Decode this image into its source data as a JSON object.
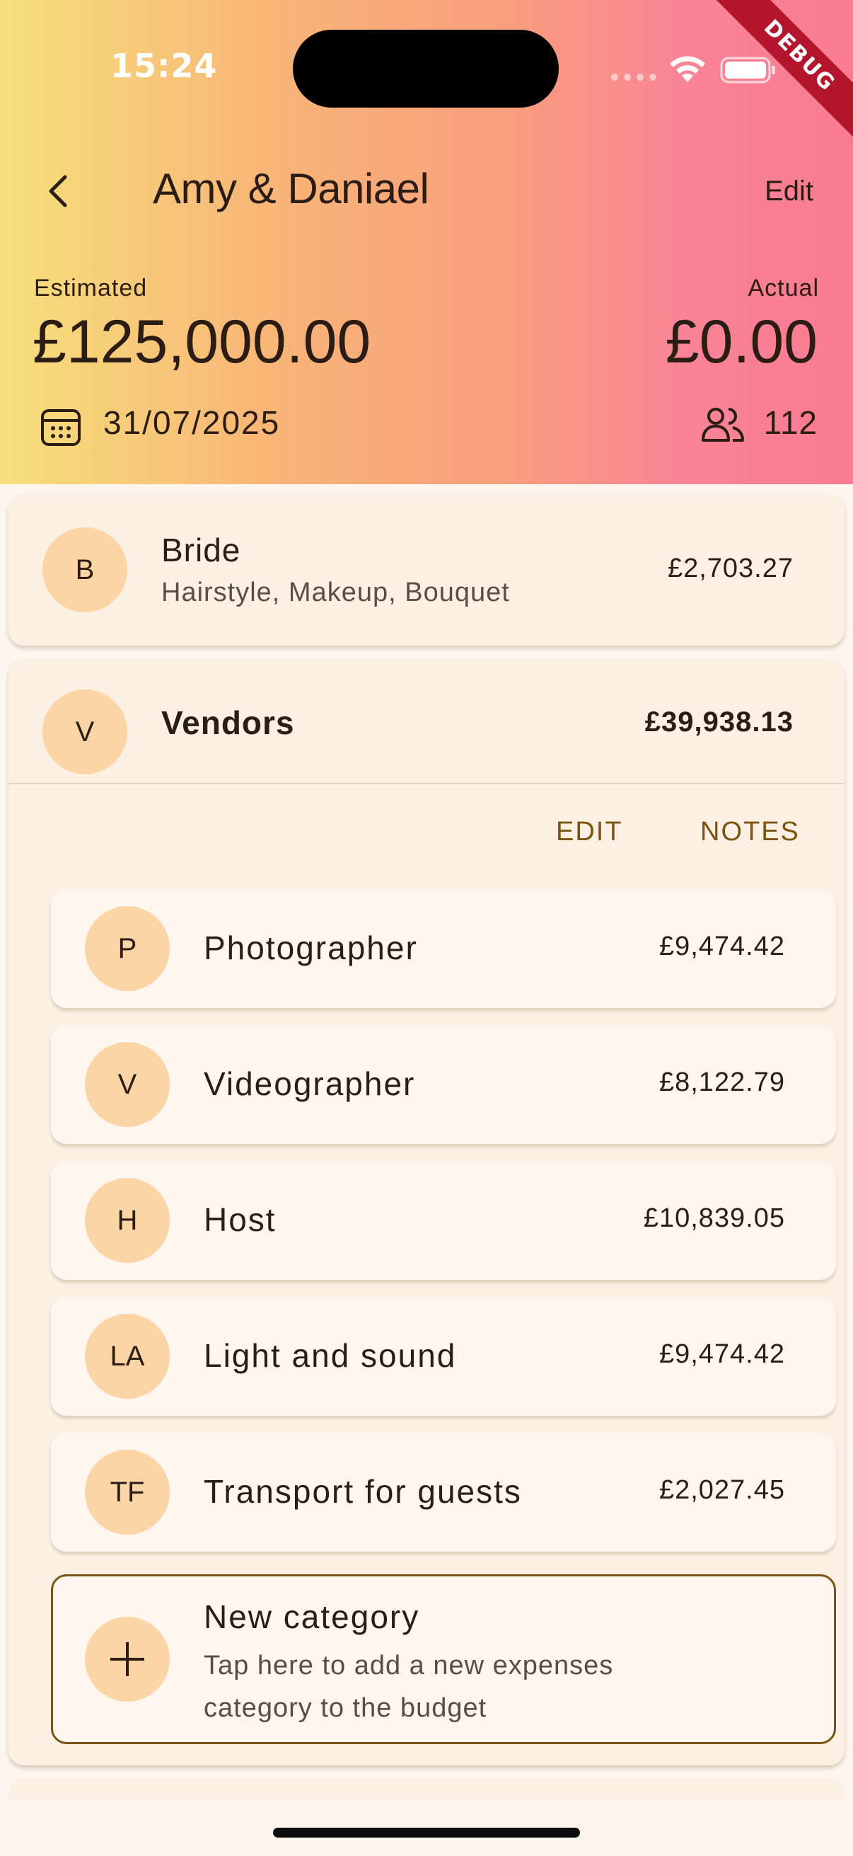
{
  "status_bar": {
    "time": "15:24"
  },
  "debug_banner": "DEBUG",
  "header": {
    "title": "Amy & Daniael",
    "edit_label": "Edit",
    "estimated_label": "Estimated",
    "estimated_value": "£125,000.00",
    "actual_label": "Actual",
    "actual_value": "£0.00",
    "date": "31/07/2025",
    "guest_count": "112",
    "icons": {
      "back": "chevron-left-icon",
      "calendar": "calendar-icon",
      "guests": "people-icon"
    }
  },
  "categories": {
    "bride": {
      "initial": "B",
      "name": "Bride",
      "subtitle": "Hairstyle, Makeup, Bouquet",
      "amount": "£2,703.27"
    },
    "vendors": {
      "initial": "V",
      "name": "Vendors",
      "amount": "£39,938.13",
      "actions": {
        "edit": "EDIT",
        "notes": "NOTES"
      },
      "items": [
        {
          "initial": "P",
          "label": "Photographer",
          "amount": "£9,474.42"
        },
        {
          "initial": "V",
          "label": "Videographer",
          "amount": "£8,122.79"
        },
        {
          "initial": "H",
          "label": "Host",
          "amount": "£10,839.05"
        },
        {
          "initial": "LA",
          "label": "Light and sound",
          "amount": "£9,474.42"
        },
        {
          "initial": "TF",
          "label": "Transport for guests",
          "amount": "£2,027.45"
        }
      ]
    }
  },
  "new_category": {
    "title": "New category",
    "description": "Tap here to add a new expenses category to the budget",
    "icon": "plus-icon"
  },
  "colors": {
    "avatar_bg": "#fcd5a6",
    "accent": "#7a5410",
    "gradient": [
      "#f6e07c",
      "#f8b777",
      "#f99d7d",
      "#f97b92"
    ]
  }
}
